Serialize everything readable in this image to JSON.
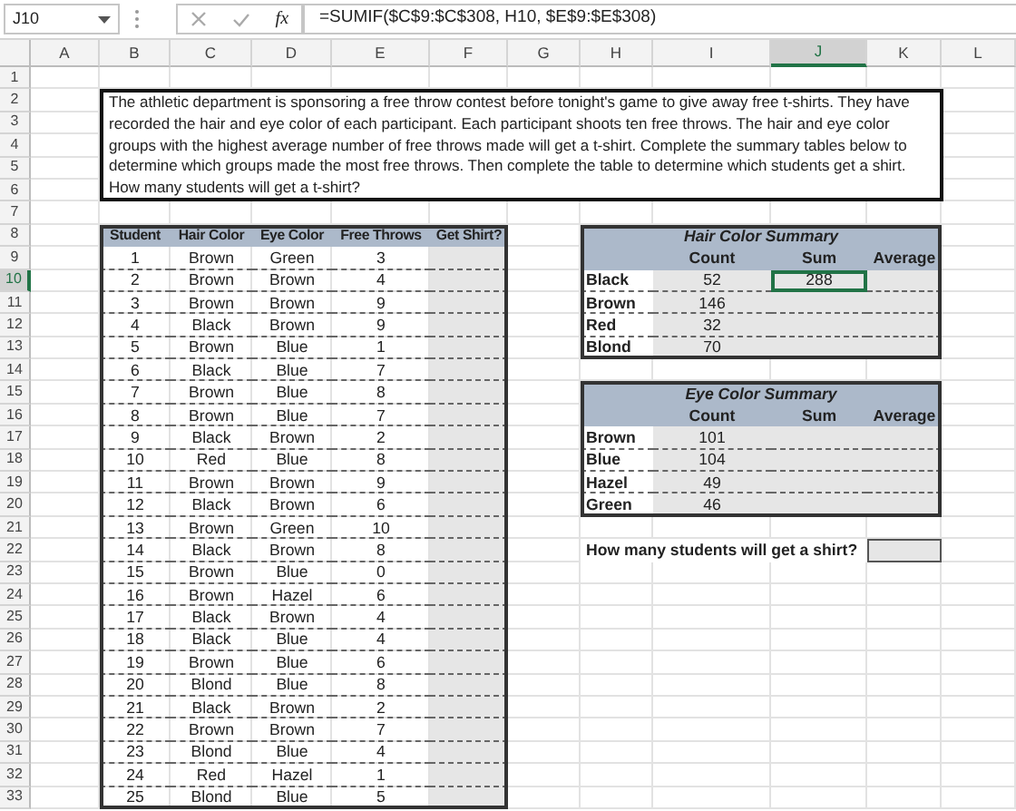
{
  "formula_bar": {
    "name_box": "J10",
    "function_label": "fx",
    "formula": "=SUMIF($C$9:$C$308, H10, $E$9:$E$308)"
  },
  "columns": [
    {
      "label": "A",
      "selected": false
    },
    {
      "label": "B",
      "selected": false
    },
    {
      "label": "C",
      "selected": false
    },
    {
      "label": "D",
      "selected": false
    },
    {
      "label": "E",
      "selected": false
    },
    {
      "label": "F",
      "selected": false
    },
    {
      "label": "G",
      "selected": false
    },
    {
      "label": "H",
      "selected": false
    },
    {
      "label": "I",
      "selected": false
    },
    {
      "label": "J",
      "selected": true
    },
    {
      "label": "K",
      "selected": false
    },
    {
      "label": "L",
      "selected": false
    }
  ],
  "rows": [
    {
      "label": "1",
      "selected": false
    },
    {
      "label": "2",
      "selected": false
    },
    {
      "label": "3",
      "selected": false
    },
    {
      "label": "4",
      "selected": false
    },
    {
      "label": "5",
      "selected": false
    },
    {
      "label": "6",
      "selected": false
    },
    {
      "label": "7",
      "selected": false
    },
    {
      "label": "8",
      "selected": false
    },
    {
      "label": "9",
      "selected": false
    },
    {
      "label": "10",
      "selected": true
    },
    {
      "label": "11",
      "selected": false
    },
    {
      "label": "12",
      "selected": false
    },
    {
      "label": "13",
      "selected": false
    },
    {
      "label": "14",
      "selected": false
    },
    {
      "label": "15",
      "selected": false
    },
    {
      "label": "16",
      "selected": false
    },
    {
      "label": "17",
      "selected": false
    },
    {
      "label": "18",
      "selected": false
    },
    {
      "label": "19",
      "selected": false
    },
    {
      "label": "20",
      "selected": false
    },
    {
      "label": "21",
      "selected": false
    },
    {
      "label": "22",
      "selected": false
    },
    {
      "label": "23",
      "selected": false
    },
    {
      "label": "24",
      "selected": false
    },
    {
      "label": "25",
      "selected": false
    },
    {
      "label": "26",
      "selected": false
    },
    {
      "label": "27",
      "selected": false
    },
    {
      "label": "28",
      "selected": false
    },
    {
      "label": "29",
      "selected": false
    },
    {
      "label": "30",
      "selected": false
    },
    {
      "label": "31",
      "selected": false
    },
    {
      "label": "32",
      "selected": false
    },
    {
      "label": "33",
      "selected": false
    }
  ],
  "prompt": "The athletic department is sponsoring a free throw contest before tonight's game to give away free t-shirts. They have recorded the hair and eye color of each participant. Each participant shoots ten free throws. The hair and eye color groups with the highest average number of free throws made will get a t-shirt. Complete the summary tables below to determine which groups made the most free throws. Then complete the table to determine which students get a shirt. How many students will get a t-shirt?",
  "student_table": {
    "columns": [
      "Student",
      "Hair Color",
      "Eye Color",
      "Free Throws",
      "Get Shirt?"
    ],
    "rows": [
      [
        "1",
        "Brown",
        "Green",
        "3"
      ],
      [
        "2",
        "Brown",
        "Brown",
        "4"
      ],
      [
        "3",
        "Brown",
        "Brown",
        "9"
      ],
      [
        "4",
        "Black",
        "Brown",
        "9"
      ],
      [
        "5",
        "Brown",
        "Blue",
        "1"
      ],
      [
        "6",
        "Black",
        "Blue",
        "7"
      ],
      [
        "7",
        "Brown",
        "Blue",
        "8"
      ],
      [
        "8",
        "Brown",
        "Blue",
        "7"
      ],
      [
        "9",
        "Black",
        "Brown",
        "2"
      ],
      [
        "10",
        "Red",
        "Blue",
        "8"
      ],
      [
        "11",
        "Brown",
        "Brown",
        "9"
      ],
      [
        "12",
        "Black",
        "Brown",
        "6"
      ],
      [
        "13",
        "Brown",
        "Green",
        "10"
      ],
      [
        "14",
        "Black",
        "Brown",
        "8"
      ],
      [
        "15",
        "Brown",
        "Blue",
        "0"
      ],
      [
        "16",
        "Brown",
        "Hazel",
        "6"
      ],
      [
        "17",
        "Black",
        "Brown",
        "4"
      ],
      [
        "18",
        "Black",
        "Blue",
        "4"
      ],
      [
        "19",
        "Brown",
        "Blue",
        "6"
      ],
      [
        "20",
        "Blond",
        "Blue",
        "8"
      ],
      [
        "21",
        "Black",
        "Brown",
        "2"
      ],
      [
        "22",
        "Brown",
        "Brown",
        "7"
      ],
      [
        "23",
        "Blond",
        "Blue",
        "4"
      ],
      [
        "24",
        "Red",
        "Hazel",
        "1"
      ],
      [
        "25",
        "Blond",
        "Blue",
        "5"
      ]
    ]
  },
  "hair_summary": {
    "title": "Hair Color Summary",
    "columns": [
      "Count",
      "Sum",
      "Average"
    ],
    "rows": [
      {
        "label": "Black",
        "count": "52",
        "sum": "288",
        "sum_selected": true
      },
      {
        "label": "Brown",
        "count": "146",
        "sum_selected": false
      },
      {
        "label": "Red",
        "count": "32",
        "sum_selected": false
      },
      {
        "label": "Blond",
        "count": "70",
        "sum_selected": false
      }
    ]
  },
  "eye_summary": {
    "title": "Eye Color Summary",
    "columns": [
      "Count",
      "Sum",
      "Average"
    ],
    "rows": [
      {
        "label": "Brown",
        "count": "101"
      },
      {
        "label": "Blue",
        "count": "104"
      },
      {
        "label": "Hazel",
        "count": "49"
      },
      {
        "label": "Green",
        "count": "46"
      }
    ]
  },
  "question": {
    "label": "How many students will get a shirt?"
  }
}
